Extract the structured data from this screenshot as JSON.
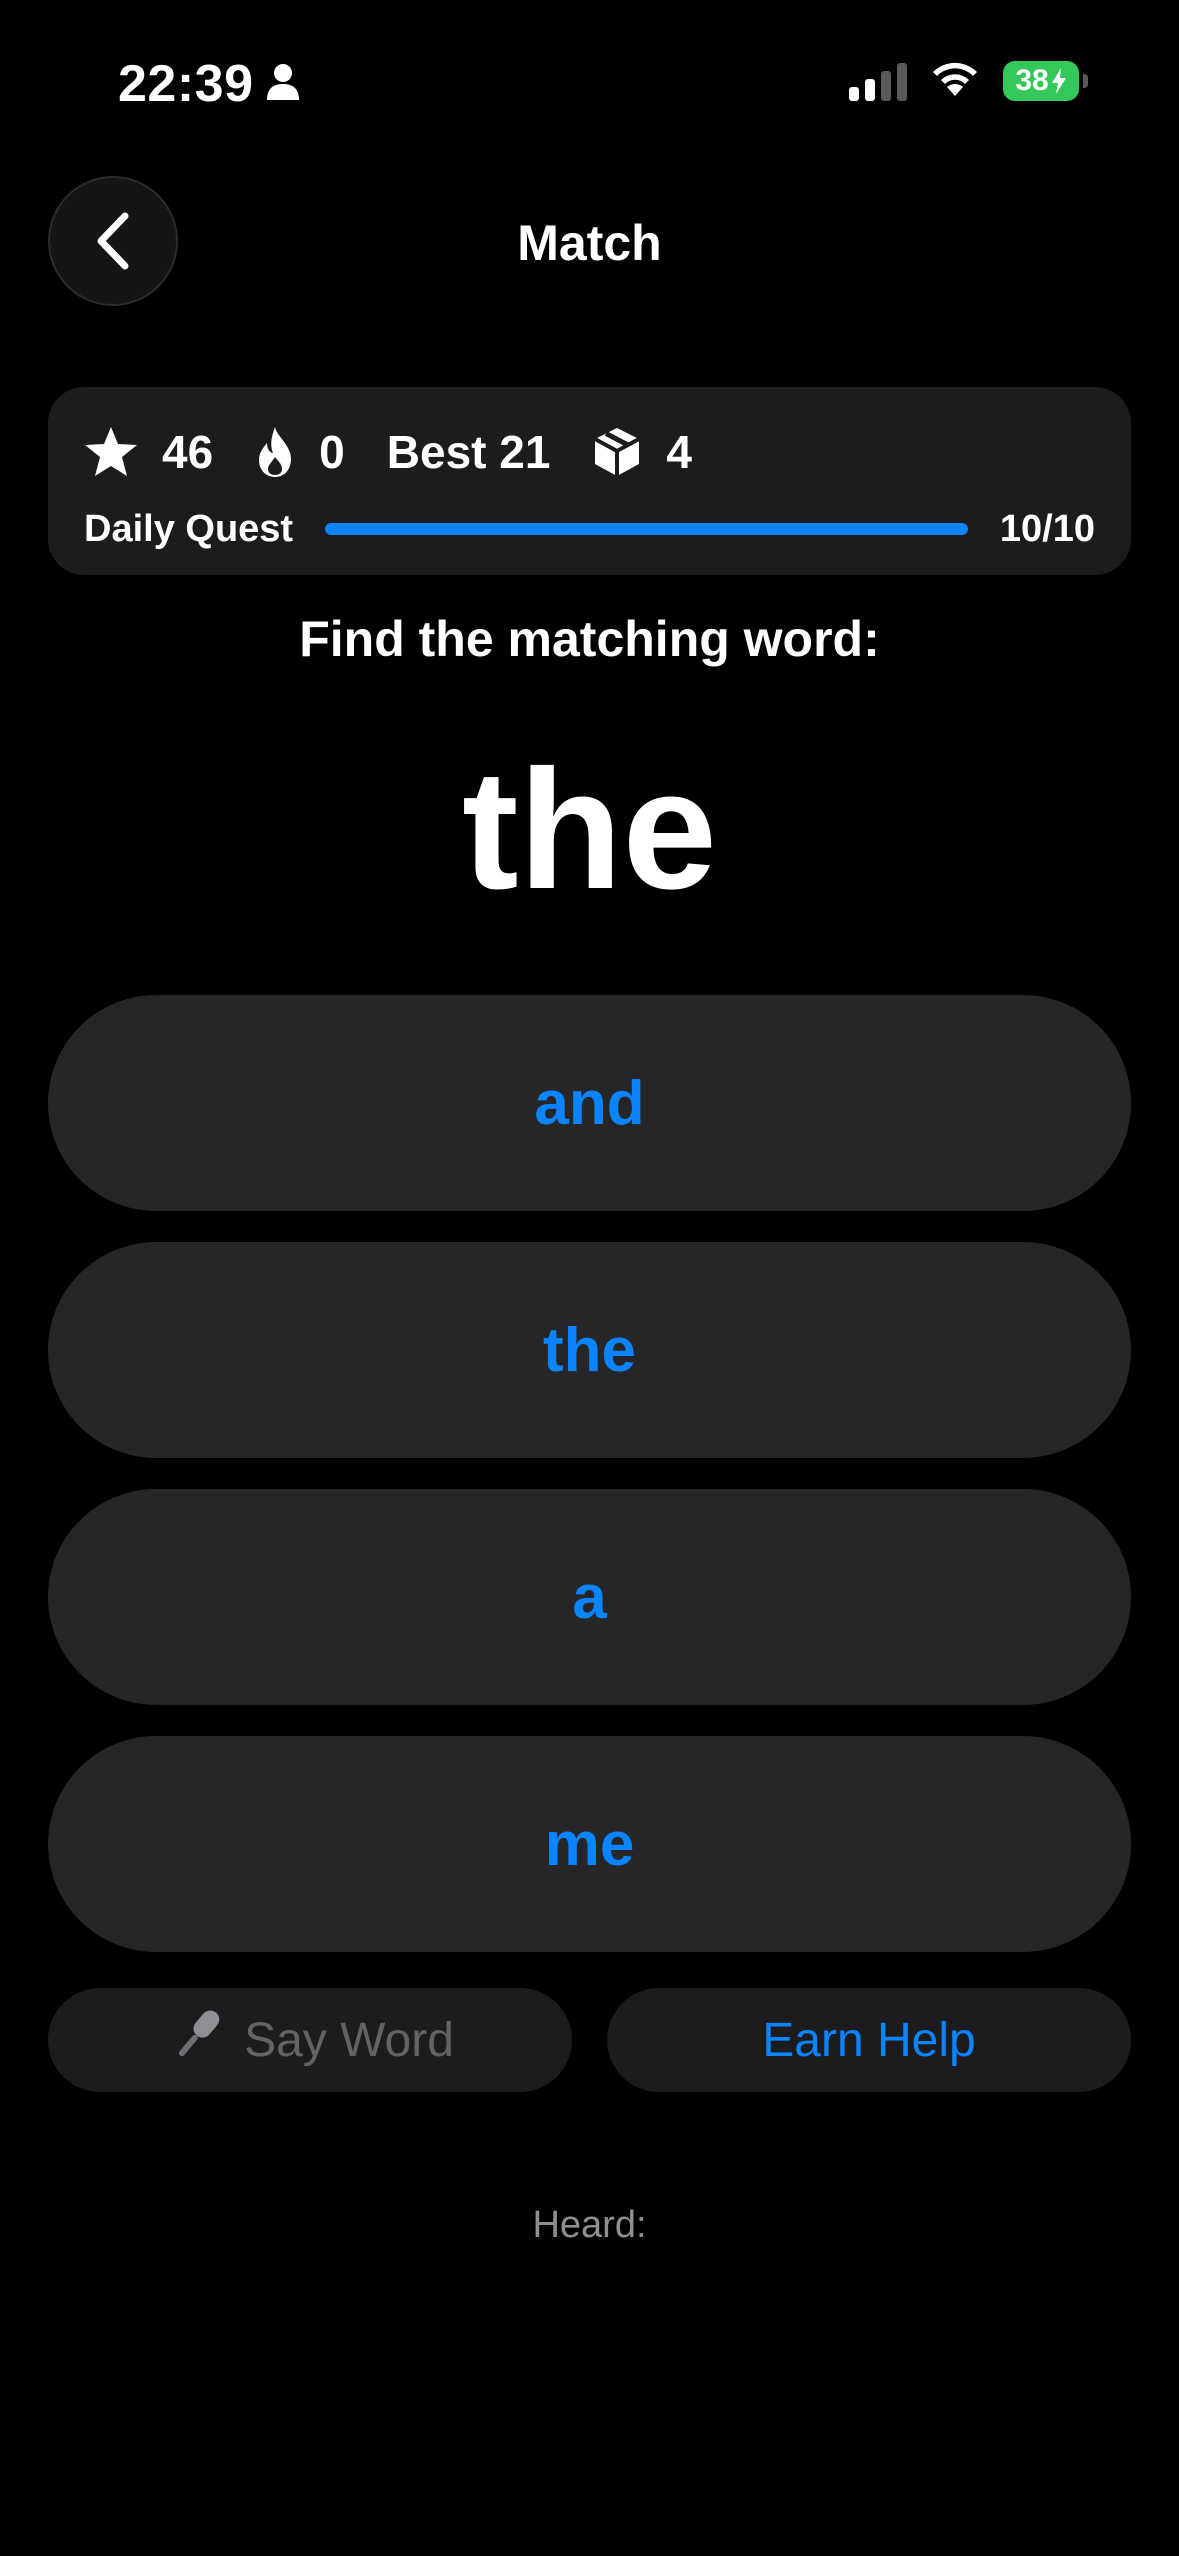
{
  "status_bar": {
    "time": "22:39",
    "battery": "38",
    "icons": [
      "person-icon",
      "signal-icon",
      "wifi-icon",
      "battery-charging-icon"
    ]
  },
  "nav": {
    "title": "Match",
    "back_icon": "chevron-left-icon"
  },
  "stats": {
    "stars": "46",
    "streak": "0",
    "best": "Best 21",
    "boxes": "4",
    "icons": [
      "star-icon",
      "flame-icon",
      "box-icon"
    ]
  },
  "quest": {
    "label": "Daily Quest",
    "progress_text": "10/10",
    "progress_fraction": 1.0
  },
  "prompt": "Find the matching word:",
  "target_word": "the",
  "choices": [
    "and",
    "the",
    "a",
    "me"
  ],
  "actions": {
    "say_word": "Say Word",
    "say_word_icon": "microphone-icon",
    "earn_help": "Earn Help"
  },
  "heard_label": "Heard:",
  "colors": {
    "accent": "#0a84ff",
    "background": "#000000",
    "card": "#1c1c1e",
    "choice_bg": "#262628",
    "battery": "#34c759"
  }
}
